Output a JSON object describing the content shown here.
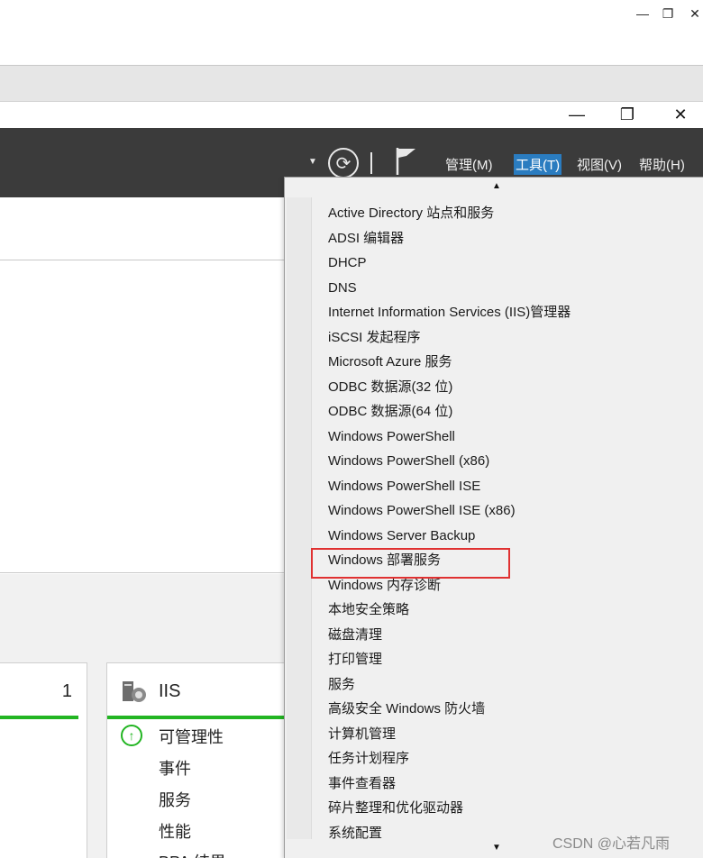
{
  "window_controls": {
    "minimize": "—",
    "restore": "❐",
    "close": "✕"
  },
  "toolbar": {
    "menus": [
      {
        "label": "管理(M)"
      },
      {
        "label": "工具(T)"
      },
      {
        "label": "视图(V)"
      },
      {
        "label": "帮助(H)"
      }
    ],
    "active_menu": "工具(T)"
  },
  "tiles": {
    "left_count": "1",
    "iis_title": "IIS",
    "iis_rows": [
      "可管理性",
      "事件",
      "服务",
      "性能",
      "BPA 结果"
    ]
  },
  "tools_menu": {
    "items": [
      "Active Directory 站点和服务",
      "ADSI 编辑器",
      "DHCP",
      "DNS",
      "Internet Information Services (IIS)管理器",
      "iSCSI 发起程序",
      "Microsoft Azure 服务",
      "ODBC 数据源(32 位)",
      "ODBC 数据源(64 位)",
      "Windows PowerShell",
      "Windows PowerShell (x86)",
      "Windows PowerShell ISE",
      "Windows PowerShell ISE (x86)",
      "Windows Server Backup",
      "Windows 部署服务",
      "Windows 内存诊断",
      "本地安全策略",
      "磁盘清理",
      "打印管理",
      "服务",
      "高级安全 Windows 防火墙",
      "计算机管理",
      "任务计划程序",
      "事件查看器",
      "碎片整理和优化驱动器",
      "系统配置"
    ],
    "highlighted_item": "Windows 部署服务"
  },
  "watermark": "CSDN @心若凡雨",
  "colors": {
    "menubar": "#3b3b3b",
    "active_menu": "#2a7cc0",
    "highlight_box": "#e03131",
    "status_green": "#22b522"
  }
}
